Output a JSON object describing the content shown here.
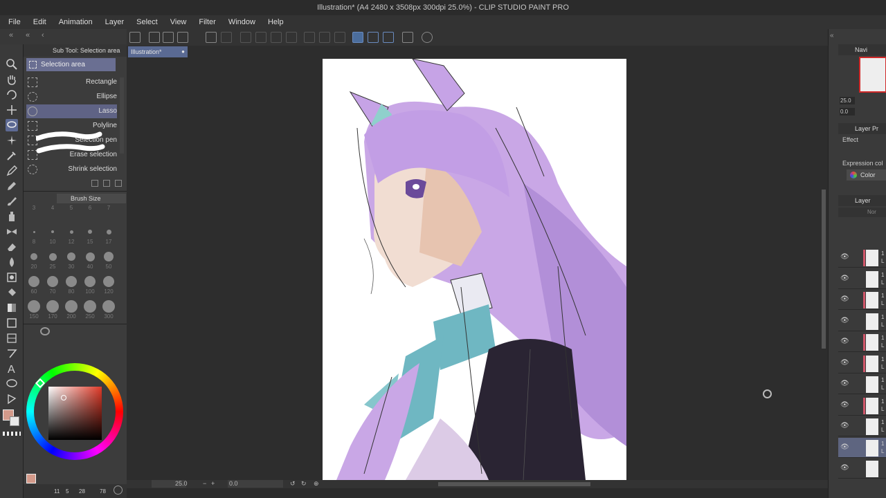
{
  "window": {
    "title": "Illustration* (A4 2480 x 3508px 300dpi 25.0%) - CLIP STUDIO PAINT PRO"
  },
  "menu": [
    "File",
    "Edit",
    "Animation",
    "Layer",
    "Select",
    "View",
    "Filter",
    "Window",
    "Help"
  ],
  "subtool_panel": {
    "header": "Sub Tool: Selection area",
    "group_label": "Selection area",
    "items": [
      {
        "label": "Rectangle",
        "selected": false
      },
      {
        "label": "Ellipse",
        "selected": false
      },
      {
        "label": "Lasso",
        "selected": true
      },
      {
        "label": "Polyline",
        "selected": false
      },
      {
        "label": "Selection pen",
        "selected": false
      },
      {
        "label": "Erase selection",
        "selected": false
      },
      {
        "label": "Shrink selection",
        "selected": false
      }
    ]
  },
  "brush_size_panel": {
    "header": "Brush Size",
    "sizes": [
      "3",
      "4",
      "5",
      "6",
      "7",
      "8",
      "10",
      "12",
      "15",
      "17",
      "20",
      "25",
      "30",
      "40",
      "50",
      "60",
      "70",
      "80",
      "100",
      "120",
      "150",
      "170",
      "200",
      "250",
      "300"
    ]
  },
  "color_panel": {
    "main_color": "#d49a8a",
    "sub_color": "#e9e9e9"
  },
  "canvas_tab": {
    "label": "Illustration*"
  },
  "status_bar": {
    "zoom": "25.0",
    "angle": "0.0"
  },
  "left_bottom": {
    "values": [
      "11",
      "5",
      "28",
      "78"
    ]
  },
  "right_panel": {
    "navigator_header": "Navi",
    "nav_zoom": "25.0",
    "nav_angle": "0.0",
    "layer_property_header": "Layer Pr",
    "effect_label": "Effect",
    "expression_color_label": "Expression col",
    "color_button_label": "Color",
    "layer_header": "Layer",
    "blend_mode": "Nor",
    "layers": [
      {
        "num": "1",
        "kind": "L",
        "strip": true,
        "active": false
      },
      {
        "num": "1",
        "kind": "L",
        "strip": false,
        "active": false
      },
      {
        "num": "1",
        "kind": "L",
        "strip": true,
        "active": false
      },
      {
        "num": "1",
        "kind": "L",
        "strip": false,
        "active": false
      },
      {
        "num": "1",
        "kind": "L",
        "strip": true,
        "active": false
      },
      {
        "num": "1",
        "kind": "L",
        "strip": true,
        "active": false
      },
      {
        "num": "1",
        "kind": "L",
        "strip": false,
        "active": false
      },
      {
        "num": "1",
        "kind": "L",
        "strip": true,
        "active": false
      },
      {
        "num": "1",
        "kind": "L",
        "strip": false,
        "active": false
      },
      {
        "num": "1",
        "kind": "L",
        "strip": false,
        "active": true
      },
      {
        "num": "",
        "kind": "",
        "strip": false,
        "active": false
      }
    ]
  }
}
